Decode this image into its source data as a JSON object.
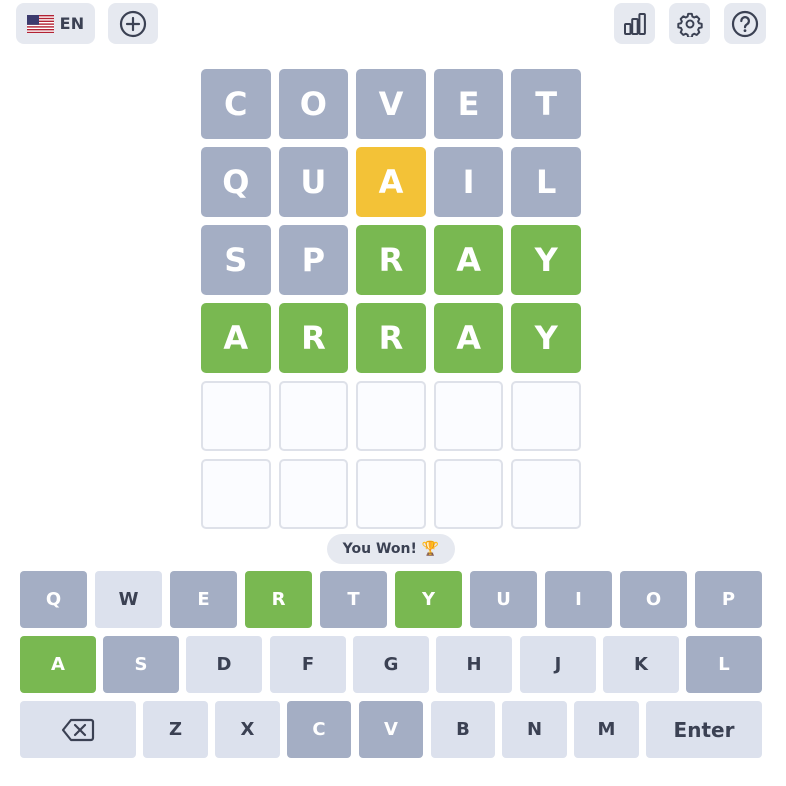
{
  "header": {
    "language_code": "EN",
    "icons": [
      "us-flag-icon",
      "plus-circle-icon",
      "bar-chart-icon",
      "gear-icon",
      "question-circle-icon"
    ]
  },
  "board": {
    "rows": [
      [
        {
          "letter": "C",
          "state": "absent"
        },
        {
          "letter": "O",
          "state": "absent"
        },
        {
          "letter": "V",
          "state": "absent"
        },
        {
          "letter": "E",
          "state": "absent"
        },
        {
          "letter": "T",
          "state": "absent"
        }
      ],
      [
        {
          "letter": "Q",
          "state": "absent"
        },
        {
          "letter": "U",
          "state": "absent"
        },
        {
          "letter": "A",
          "state": "present"
        },
        {
          "letter": "I",
          "state": "absent"
        },
        {
          "letter": "L",
          "state": "absent"
        }
      ],
      [
        {
          "letter": "S",
          "state": "absent"
        },
        {
          "letter": "P",
          "state": "absent"
        },
        {
          "letter": "R",
          "state": "correct"
        },
        {
          "letter": "A",
          "state": "correct"
        },
        {
          "letter": "Y",
          "state": "correct"
        }
      ],
      [
        {
          "letter": "A",
          "state": "correct"
        },
        {
          "letter": "R",
          "state": "correct"
        },
        {
          "letter": "R",
          "state": "correct"
        },
        {
          "letter": "A",
          "state": "correct"
        },
        {
          "letter": "Y",
          "state": "correct"
        }
      ],
      [
        {
          "letter": "",
          "state": "empty"
        },
        {
          "letter": "",
          "state": "empty"
        },
        {
          "letter": "",
          "state": "empty"
        },
        {
          "letter": "",
          "state": "empty"
        },
        {
          "letter": "",
          "state": "empty"
        }
      ],
      [
        {
          "letter": "",
          "state": "empty"
        },
        {
          "letter": "",
          "state": "empty"
        },
        {
          "letter": "",
          "state": "empty"
        },
        {
          "letter": "",
          "state": "empty"
        },
        {
          "letter": "",
          "state": "empty"
        }
      ]
    ]
  },
  "toast": {
    "message": "You Won!",
    "emoji": "🏆"
  },
  "keyboard": {
    "rows": [
      [
        {
          "label": "Q",
          "state": "absent"
        },
        {
          "label": "W",
          "state": "unused"
        },
        {
          "label": "E",
          "state": "absent"
        },
        {
          "label": "R",
          "state": "correct"
        },
        {
          "label": "T",
          "state": "absent"
        },
        {
          "label": "Y",
          "state": "correct"
        },
        {
          "label": "U",
          "state": "absent"
        },
        {
          "label": "I",
          "state": "absent"
        },
        {
          "label": "O",
          "state": "absent"
        },
        {
          "label": "P",
          "state": "absent"
        }
      ],
      [
        {
          "label": "A",
          "state": "correct"
        },
        {
          "label": "S",
          "state": "absent"
        },
        {
          "label": "D",
          "state": "unused"
        },
        {
          "label": "F",
          "state": "unused"
        },
        {
          "label": "G",
          "state": "unused"
        },
        {
          "label": "H",
          "state": "unused"
        },
        {
          "label": "J",
          "state": "unused"
        },
        {
          "label": "K",
          "state": "unused"
        },
        {
          "label": "L",
          "state": "absent"
        }
      ],
      [
        {
          "label": "",
          "state": "unused",
          "icon": "backspace-icon"
        },
        {
          "label": "Z",
          "state": "unused"
        },
        {
          "label": "X",
          "state": "unused"
        },
        {
          "label": "C",
          "state": "absent"
        },
        {
          "label": "V",
          "state": "absent"
        },
        {
          "label": "B",
          "state": "unused"
        },
        {
          "label": "N",
          "state": "unused"
        },
        {
          "label": "M",
          "state": "unused"
        },
        {
          "label": "Enter",
          "state": "unused"
        }
      ]
    ]
  },
  "colors": {
    "absent": "#a4aec4",
    "present": "#f3c237",
    "correct": "#79b851",
    "key_unused": "#dce1ed",
    "text_dark": "#3b4153"
  }
}
